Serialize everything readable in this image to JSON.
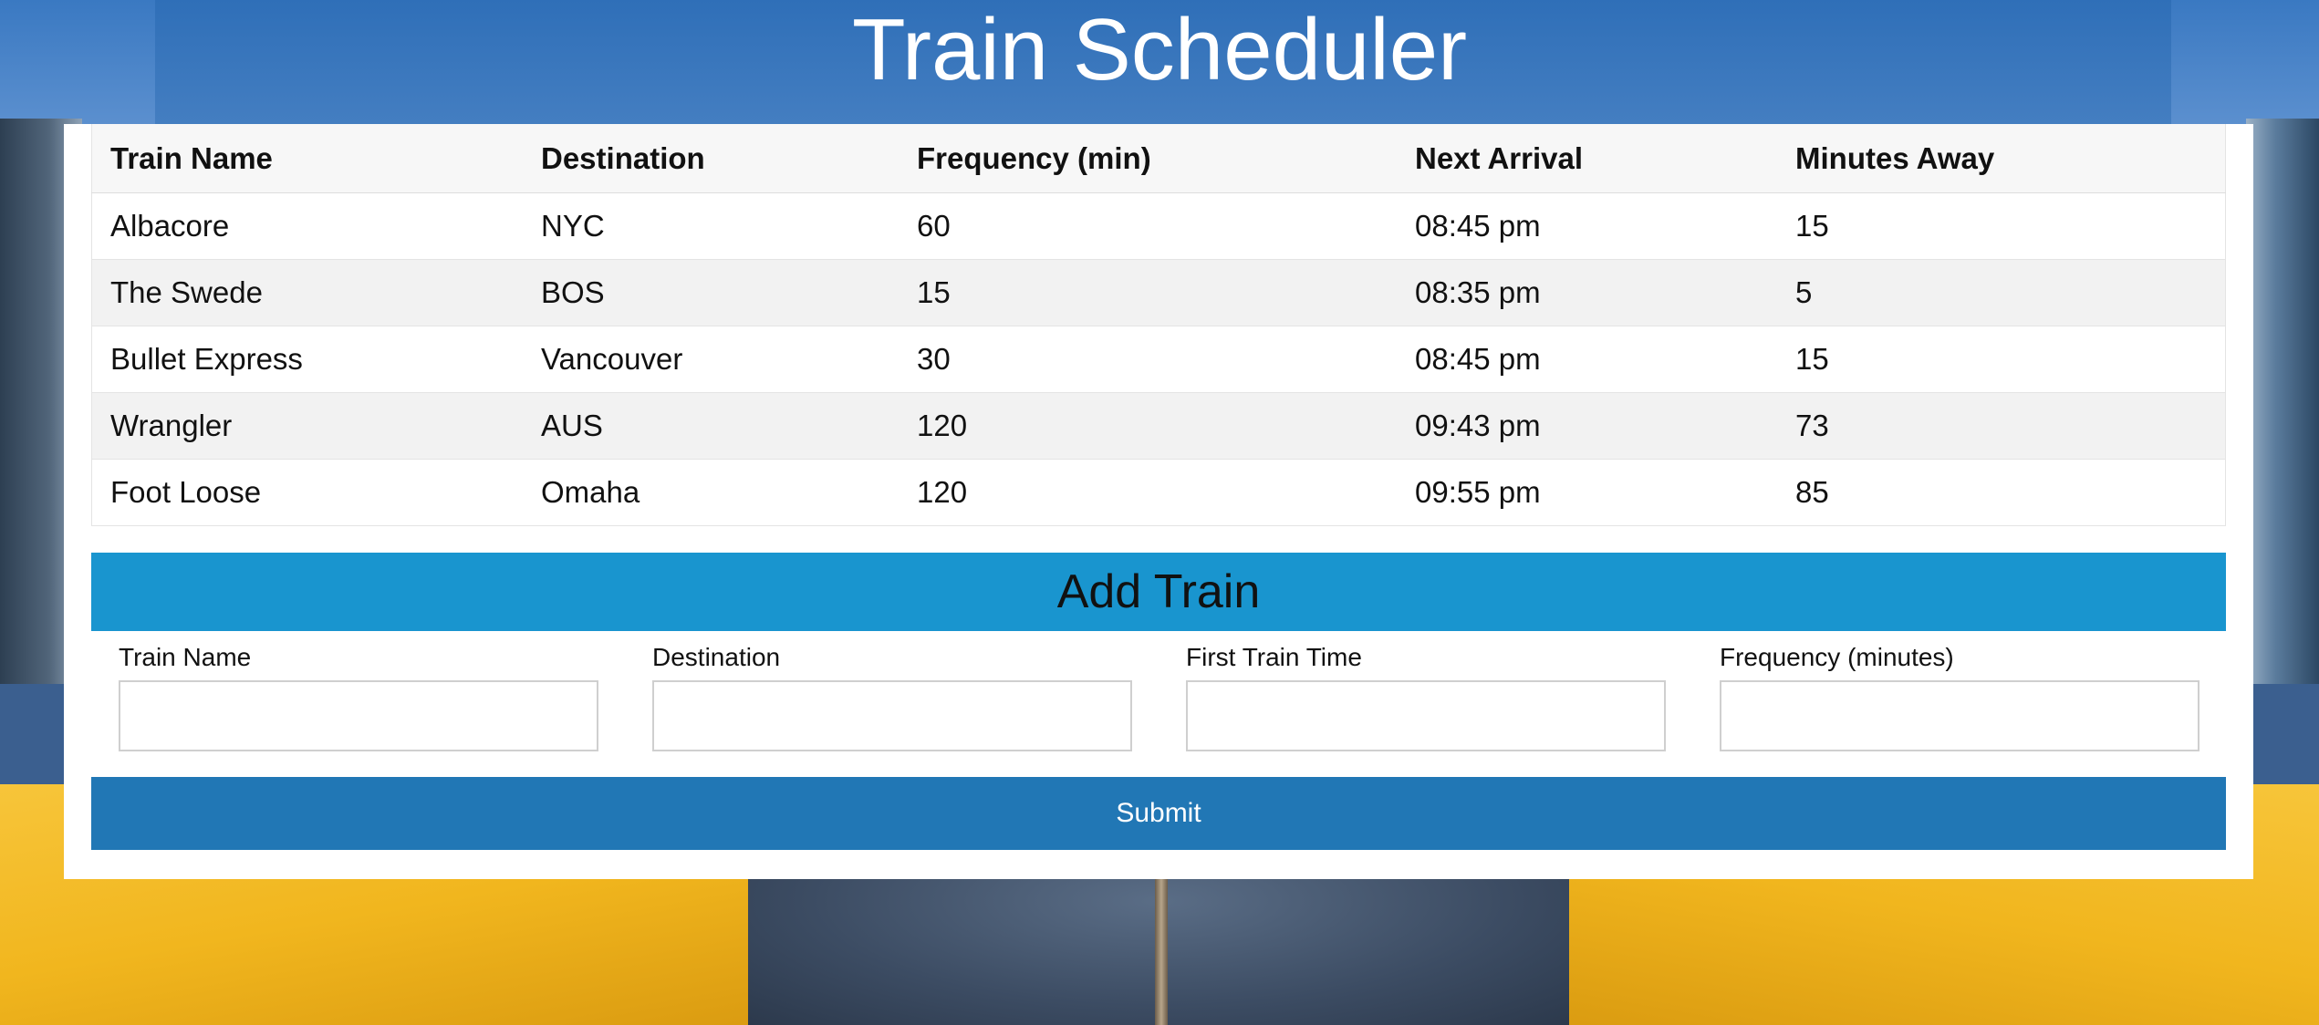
{
  "header": {
    "title": "Train Scheduler"
  },
  "schedule": {
    "columns": [
      "Train Name",
      "Destination",
      "Frequency (min)",
      "Next Arrival",
      "Minutes Away"
    ],
    "rows": [
      [
        "Albacore",
        "NYC",
        "60",
        "08:45 pm",
        "15"
      ],
      [
        "The Swede",
        "BOS",
        "15",
        "08:35 pm",
        "5"
      ],
      [
        "Bullet Express",
        "Vancouver",
        "30",
        "08:45 pm",
        "15"
      ],
      [
        "Wrangler",
        "AUS",
        "120",
        "09:43 pm",
        "73"
      ],
      [
        "Foot Loose",
        "Omaha",
        "120",
        "09:55 pm",
        "85"
      ]
    ]
  },
  "add_train": {
    "heading": "Add Train",
    "fields": [
      {
        "label": "Train Name",
        "value": ""
      },
      {
        "label": "Destination",
        "value": ""
      },
      {
        "label": "First Train Time",
        "value": ""
      },
      {
        "label": "Frequency (minutes)",
        "value": ""
      }
    ],
    "submit_label": "Submit"
  },
  "colors": {
    "add_header_bg": "#1995cf",
    "submit_bg": "#2177b5"
  }
}
